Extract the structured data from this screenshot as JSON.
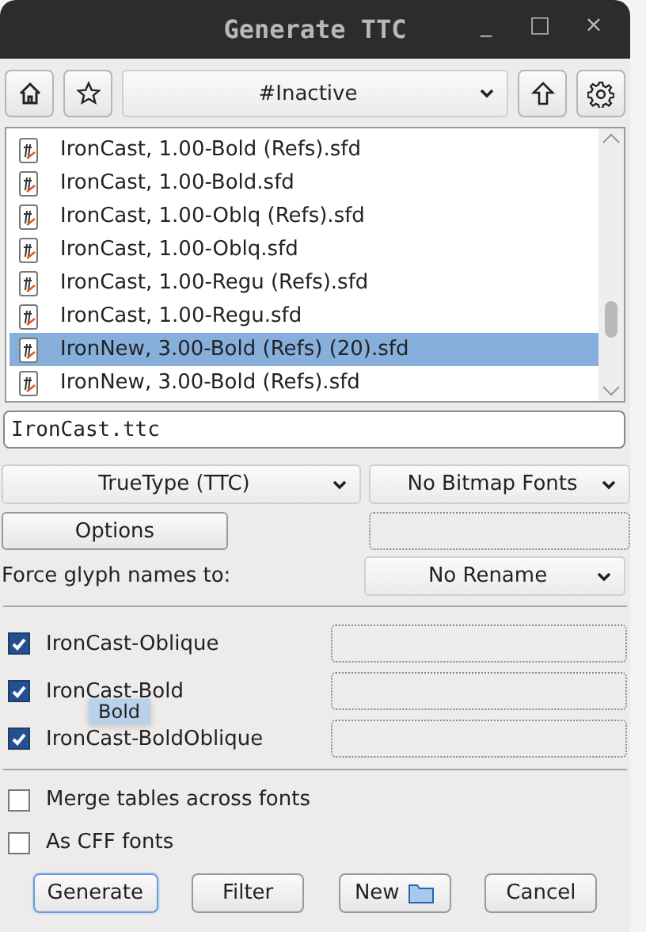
{
  "window": {
    "title": "Generate TTC",
    "controls": [
      "_",
      "□",
      "×"
    ]
  },
  "toolbar": {
    "path": "#Inactive"
  },
  "files": [
    {
      "name": "IronCast, 1.00-Bold (Refs).sfd",
      "selected": false
    },
    {
      "name": "IronCast, 1.00-Bold.sfd",
      "selected": false
    },
    {
      "name": "IronCast, 1.00-Oblq (Refs).sfd",
      "selected": false
    },
    {
      "name": "IronCast, 1.00-Oblq.sfd",
      "selected": false
    },
    {
      "name": "IronCast, 1.00-Regu (Refs).sfd",
      "selected": false
    },
    {
      "name": "IronCast, 1.00-Regu.sfd",
      "selected": false
    },
    {
      "name": "IronNew, 3.00-Bold (Refs) (20).sfd",
      "selected": true
    },
    {
      "name": "IronNew, 3.00-Bold (Refs).sfd",
      "selected": false
    }
  ],
  "filename": {
    "value": "IronCast.ttc"
  },
  "format": "TrueType (TTC)",
  "bitmap": "No Bitmap Fonts",
  "options_button": "Options",
  "force_glyph": {
    "label": "Force glyph names to:",
    "value": "No Rename"
  },
  "fonts": [
    {
      "name": "IronCast-Oblique",
      "checked": true
    },
    {
      "name": "IronCast-Bold",
      "checked": true
    },
    {
      "name": "IronCast-BoldOblique",
      "checked": true
    }
  ],
  "tooltip": "Bold",
  "options": [
    {
      "label": "Merge tables across fonts",
      "checked": false
    },
    {
      "label": "As CFF fonts",
      "checked": false
    }
  ],
  "buttons": [
    "Generate",
    "Filter",
    "New",
    "Cancel"
  ]
}
